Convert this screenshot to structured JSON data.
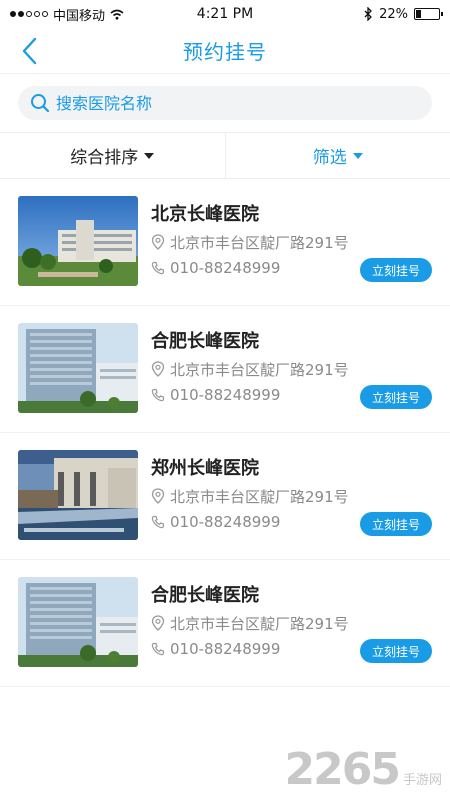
{
  "status_bar": {
    "carrier": "中国移动",
    "time": "4:21 PM",
    "battery_text": "22%",
    "battery_level": 0.22
  },
  "nav": {
    "title": "预约挂号"
  },
  "search": {
    "placeholder": "搜索医院名称"
  },
  "filters": {
    "sort_label": "综合排序",
    "filter_label": "筛选"
  },
  "hospitals": [
    {
      "name": "北京长峰医院",
      "address": "北京市丰台区靛厂路291号",
      "phone": "010-88248999",
      "button": "立刻挂号"
    },
    {
      "name": "合肥长峰医院",
      "address": "北京市丰台区靛厂路291号",
      "phone": "010-88248999",
      "button": "立刻挂号"
    },
    {
      "name": "郑州长峰医院",
      "address": "北京市丰台区靛厂路291号",
      "phone": "010-88248999",
      "button": "立刻挂号"
    },
    {
      "name": "合肥长峰医院",
      "address": "北京市丰台区靛厂路291号",
      "phone": "010-88248999",
      "button": "立刻挂号"
    }
  ],
  "watermark": {
    "big": "2265",
    "small": "手游网"
  },
  "colors": {
    "accent": "#1a9be6",
    "muted_text": "#8a8a8a"
  }
}
